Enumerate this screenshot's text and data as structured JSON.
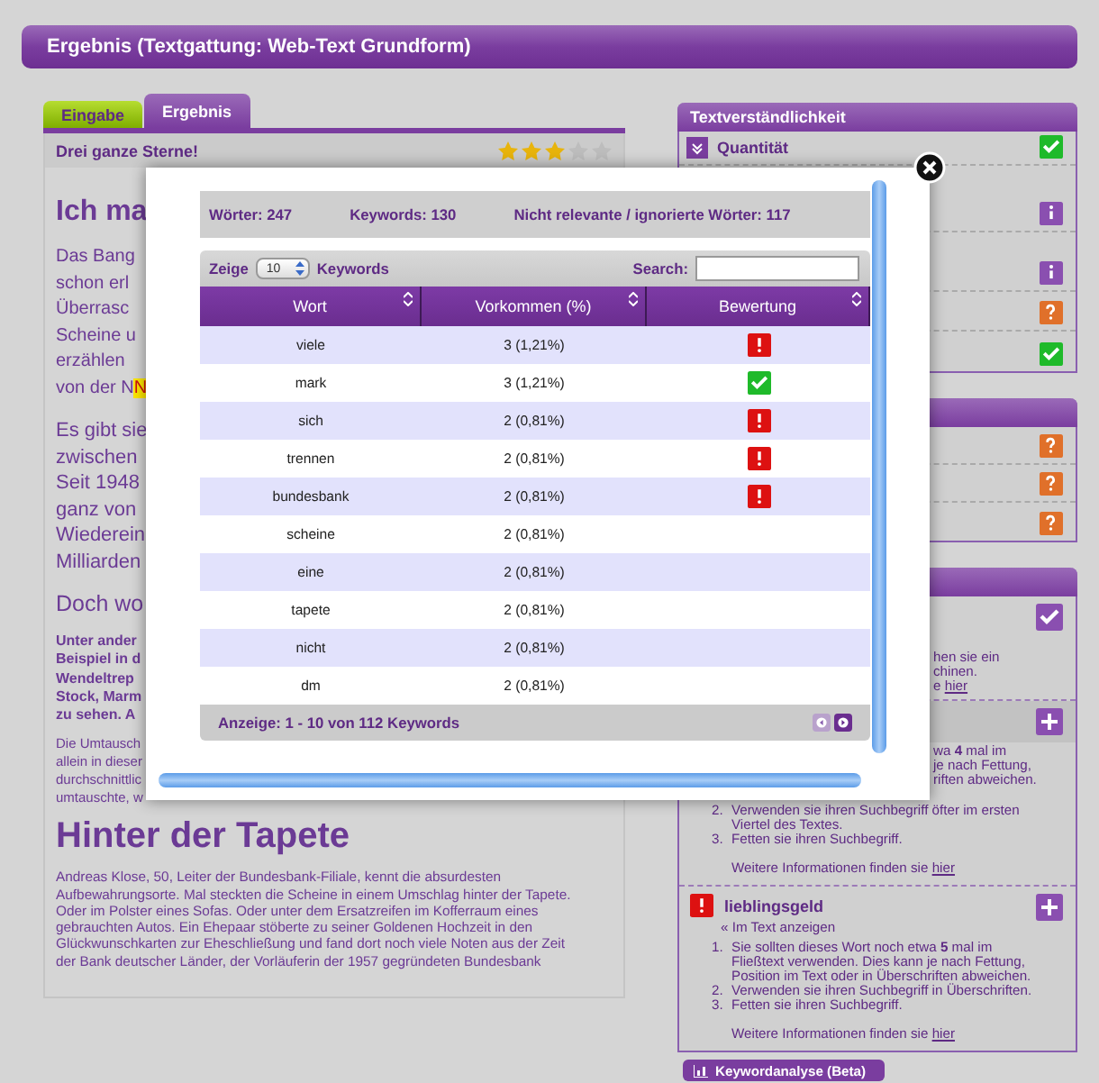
{
  "header": {
    "title": "Ergebnis (Textgattung: Web-Text Grundform)"
  },
  "tabs": [
    {
      "label": "Eingabe",
      "selected": false
    },
    {
      "label": "Ergebnis",
      "selected": true
    }
  ],
  "rating": {
    "label": "Drei ganze Sterne!",
    "stars": 3
  },
  "article": {
    "heading_1": "Ich ma",
    "paragraph_1": [
      "Das Bang",
      "schon erl",
      "Überrasc",
      "Scheine u",
      "erzählen",
      "von der N"
    ],
    "highlight": "N",
    "paragraph_2": [
      "Es gibt sie",
      "zwischen",
      "Seit 1948",
      "ganz von",
      "Wiederein",
      "Milliarden"
    ],
    "subheading": "Doch wo",
    "bold_paragraph": [
      "Unter ander",
      "Beispiel in d",
      "Wendeltrep",
      "Stock, Marm",
      "zu sehen. A"
    ],
    "small_paragraph": [
      "Die Umtausch",
      "allein in dieser",
      "durchschnittlic",
      "umtauschte, w"
    ],
    "heading_2": "Hinter der Tapete",
    "paragraph_3": [
      "Andreas Klose, 50, Leiter der Bundesbank-Filiale, kennt die absurdesten",
      "Aufbewahrungsorte. Mal steckten die Scheine in einem Umschlag hinter der Tapete.",
      "Oder im Polster eines Sofas. Oder unter dem Ersatzreifen im Kofferraum eines",
      "gebrauchten Autos. Ein Ehepaar stöberte zu seiner Goldenen Hochzeit in den",
      "Glückwunschkarten zur Eheschließung und fand dort noch viele Noten aus der Zeit",
      "der Bank deutscher Länder, der Vorläuferin der 1957 gegründeten Bundesbank"
    ]
  },
  "sidebar": {
    "panel_1": {
      "title": "Textverständlichkeit",
      "rows": [
        {
          "label": "Quantität",
          "kind": "ok"
        },
        {
          "kind": "info"
        },
        {
          "kind": "info"
        },
        {
          "kind": "warn"
        },
        {
          "kind": "ok"
        }
      ]
    },
    "panel_2": {
      "rows": [
        {
          "kind": "warn"
        },
        {
          "kind": "warn"
        },
        {
          "kind": "warn"
        }
      ]
    },
    "panel_3": {
      "items": [
        {
          "done": true,
          "highlighted": false,
          "lines": [
            "hen sie ein",
            "chinen."
          ],
          "more": "e",
          "link": "hier"
        },
        {
          "done": false,
          "highlighted": true,
          "lines": [
            "wa **4** mal im",
            "je nach Fettung,",
            "riften abweichen."
          ],
          "tips": [
            {
              "number": "2.",
              "text": "Verwenden sie ihren Suchbegriff öfter im ersten Viertel des Textes."
            },
            {
              "number": "3.",
              "text": "Fetten sie ihren Suchbegriff."
            }
          ],
          "more": "Weitere Informationen finden sie",
          "link": "hier"
        },
        {
          "done": false,
          "highlighted": false,
          "error": true,
          "keyword": "lieblingsgeld",
          "show_link": "« Im Text anzeigen",
          "tips": [
            {
              "number": "1.",
              "text": "Sie sollten dieses Wort noch etwa **5** mal im Fließtext verwenden. Dies kann je nach Fettung, Position im Text oder in Überschriften abweichen."
            },
            {
              "number": "2.",
              "text": "Verwenden sie ihren Suchbegriff in Überschriften."
            },
            {
              "number": "3.",
              "text": "Fetten sie ihren Suchbegriff."
            }
          ],
          "more": "Weitere Informationen finden sie",
          "link": "hier"
        }
      ]
    },
    "button": "Keywordanalyse (Beta)"
  },
  "modal": {
    "stats": [
      "Wörter: 247",
      "Keywords: 130",
      "Nicht relevante / ignorierte Wörter: 117"
    ],
    "controls": {
      "show_label": "Zeige",
      "page_size": "10",
      "keywords_label": "Keywords",
      "search_label": "Search:"
    },
    "columns": [
      "Wort",
      "Vorkommen (%)",
      "Bewertung"
    ],
    "rows": [
      {
        "word": "viele",
        "count": "3 (1,21%)",
        "kind": "bad"
      },
      {
        "word": "mark",
        "count": "3 (1,21%)",
        "kind": "ok"
      },
      {
        "word": "sich",
        "count": "2 (0,81%)",
        "kind": "bad"
      },
      {
        "word": "trennen",
        "count": "2 (0,81%)",
        "kind": "bad"
      },
      {
        "word": "bundesbank",
        "count": "2 (0,81%)",
        "kind": "bad"
      },
      {
        "word": "scheine",
        "count": "2 (0,81%)",
        "kind": "none"
      },
      {
        "word": "eine",
        "count": "2 (0,81%)",
        "kind": "none"
      },
      {
        "word": "tapete",
        "count": "2 (0,81%)",
        "kind": "none"
      },
      {
        "word": "nicht",
        "count": "2 (0,81%)",
        "kind": "none"
      },
      {
        "word": "dm",
        "count": "2 (0,81%)",
        "kind": "none"
      }
    ],
    "footer": "Anzeige: 1 - 10 von 112 Keywords",
    "prev": {
      "disabled": true
    },
    "next": {
      "disabled": false
    }
  }
}
